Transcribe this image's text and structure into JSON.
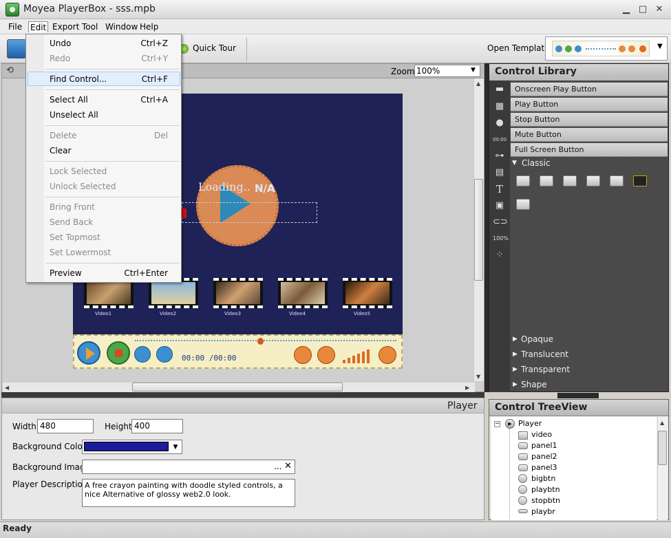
{
  "window": {
    "title": "Moyea PlayerBox - sss.mpb",
    "controls": [
      "minimize-icon",
      "maximize-icon",
      "close-icon"
    ]
  },
  "menubar": {
    "items": [
      "File",
      "Edit",
      "Export",
      "Tool",
      "Window",
      "Help"
    ]
  },
  "edit_menu": {
    "items": [
      {
        "label": "Undo",
        "shortcut": "Ctrl+Z",
        "enabled": true
      },
      {
        "label": "Redo",
        "shortcut": "Ctrl+Y",
        "enabled": false
      },
      {
        "label": "Find Control...",
        "shortcut": "Ctrl+F",
        "enabled": true,
        "highlighted": true
      },
      {
        "label": "Select All",
        "shortcut": "Ctrl+A",
        "enabled": true
      },
      {
        "label": "Unselect All",
        "shortcut": "",
        "enabled": true
      },
      {
        "label": "Delete",
        "shortcut": "Del",
        "enabled": false
      },
      {
        "label": "Clear",
        "shortcut": "",
        "enabled": true
      },
      {
        "label": "Lock Selected",
        "shortcut": "",
        "enabled": false
      },
      {
        "label": "Unlock Selected",
        "shortcut": "",
        "enabled": false
      },
      {
        "label": "Bring Front",
        "shortcut": "",
        "enabled": false
      },
      {
        "label": "Send Back",
        "shortcut": "",
        "enabled": false
      },
      {
        "label": "Set Topmost",
        "shortcut": "",
        "enabled": false
      },
      {
        "label": "Set Lowermost",
        "shortcut": "",
        "enabled": false
      },
      {
        "label": "Preview",
        "shortcut": "Ctrl+Enter",
        "enabled": true
      }
    ]
  },
  "toolbar": {
    "quick_tour": "Quick Tour",
    "open_template_label": "Open Template:"
  },
  "canvas": {
    "zoom_label": "Zoom:",
    "zoom_value": "100%",
    "loading_text": "Loading..",
    "na_text": "N/A",
    "thumbnails": [
      "Video1",
      "Video2",
      "Video3",
      "Video4",
      "Video5"
    ],
    "time_display": "00:00 /00:00",
    "seek_progress": 0.48
  },
  "properties": {
    "title": "Player",
    "width_label": "Width:",
    "width_value": "480",
    "height_label": "Height:",
    "height_value": "400",
    "bg_color_label": "Background Color:",
    "bg_color_value": "#1c1c9a",
    "bg_image_label": "Background Image:",
    "bg_image_browse": "...",
    "bg_image_clear": "✕",
    "description_label": "Player Description:",
    "description_value": "A free crayon painting with doodle styled controls, a nice Alternative of glossy web2.0 look."
  },
  "control_library": {
    "title": "Control Library",
    "categories": [
      "Onscreen Play Button",
      "Play Button",
      "Stop Button",
      "Mute Button",
      "Full Screen Button"
    ],
    "expanded_section": "Classic",
    "collapsed_sections": [
      "Opaque",
      "Translucent",
      "Transparent",
      "Shape"
    ]
  },
  "tree_view": {
    "title": "Control TreeView",
    "root": "Player",
    "children": [
      "video",
      "panel1",
      "panel2",
      "panel3",
      "bigbtn",
      "playbtn",
      "stopbtn",
      "playbr"
    ]
  },
  "status": {
    "text": "Ready"
  }
}
